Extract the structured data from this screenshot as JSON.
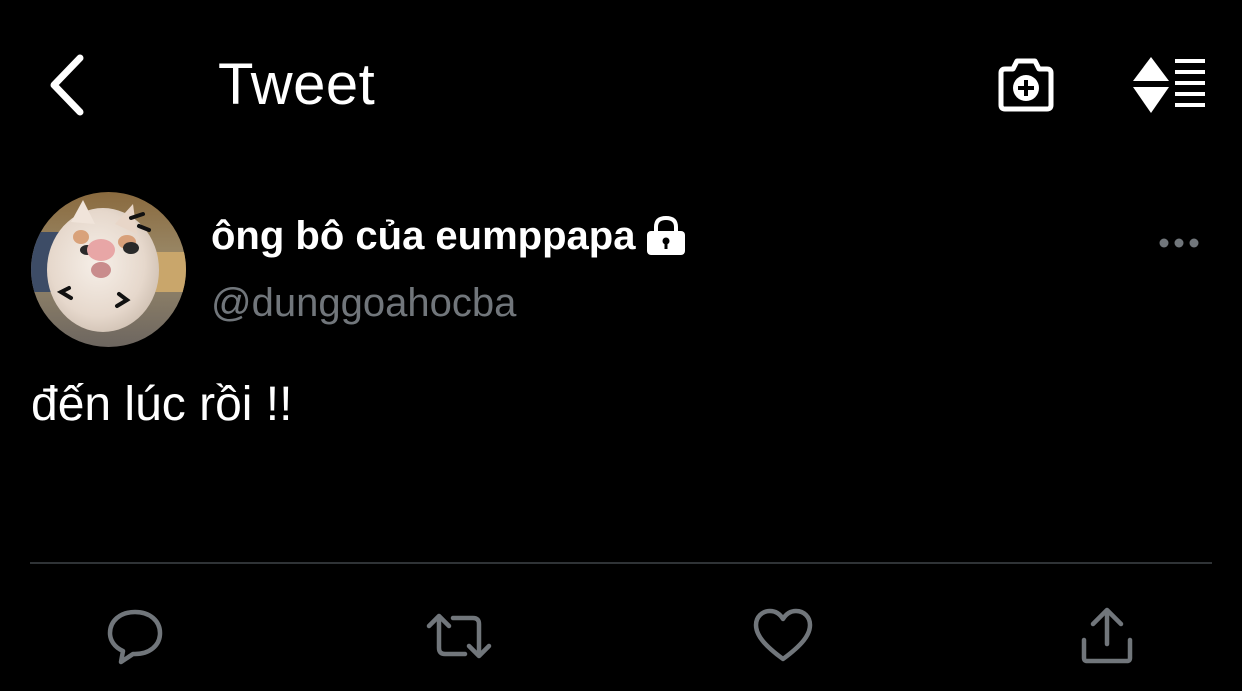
{
  "header": {
    "title": "Tweet",
    "back_icon": "chevron-left-icon",
    "camera_icon": "camera-plus-icon",
    "sort_icon": "sort-list-icon"
  },
  "tweet": {
    "author": {
      "display_name": "ông bô của eumppapa",
      "handle": "@dunggoahocba",
      "protected": true,
      "lock_icon": "lock-icon",
      "avatar": "cat-photo-avatar"
    },
    "more_icon": "more-horizontal-icon",
    "text": "đến lúc rồi !!",
    "actions": [
      {
        "name": "reply",
        "icon": "comment-icon"
      },
      {
        "name": "retweet",
        "icon": "retweet-icon"
      },
      {
        "name": "like",
        "icon": "heart-icon"
      },
      {
        "name": "share",
        "icon": "share-icon"
      }
    ]
  },
  "colors": {
    "background": "#000000",
    "text": "#ffffff",
    "secondary": "#71767b",
    "divider": "#2f3336"
  }
}
